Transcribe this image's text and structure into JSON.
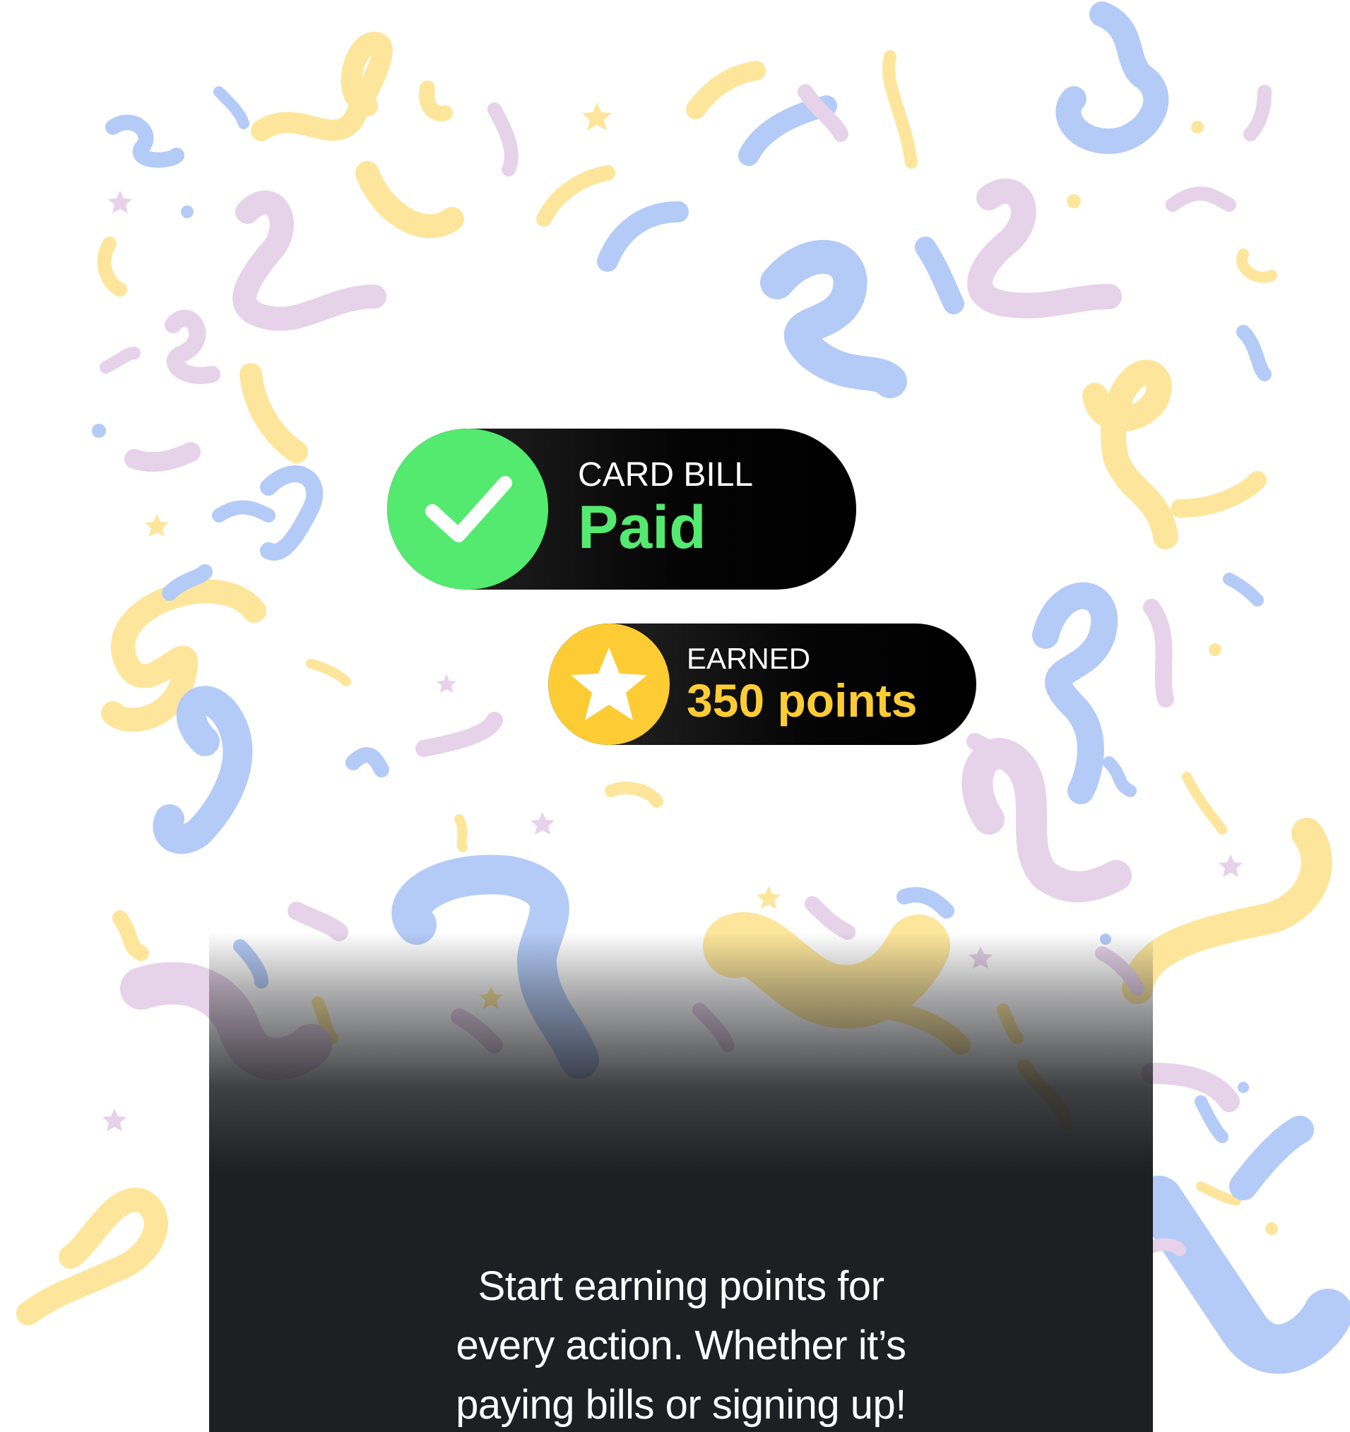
{
  "colors": {
    "confetti_yellow": "#fde69b",
    "confetti_blue": "#b4cbf7",
    "confetti_purple": "#e6d2e9",
    "success_green": "#53ea6f",
    "points_yellow": "#fdcc35",
    "panel_dark": "#1e1f22"
  },
  "icons": {
    "check": "check-icon",
    "star": "star-icon"
  },
  "bill_badge": {
    "caption": "CARD BILL",
    "status": "Paid"
  },
  "points_badge": {
    "caption": "EARNED",
    "amount": "350 points"
  },
  "footer": {
    "message": "Start earning points for every action. Whether it’s paying bills or signing up!"
  }
}
